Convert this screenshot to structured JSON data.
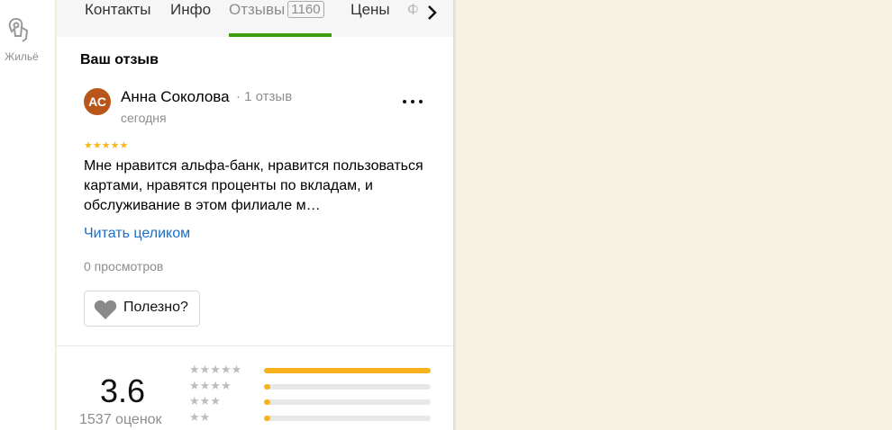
{
  "rail": {
    "housing_label": "Жильё",
    "housing_icon": "housing-icon"
  },
  "tabs": {
    "items": [
      {
        "label": "Контакты"
      },
      {
        "label": "Инфо"
      },
      {
        "label": "Отзывы",
        "badge": "1160",
        "active": true
      },
      {
        "label": "Цены"
      },
      {
        "label": "Ф"
      }
    ],
    "next_icon": "chevron-right-icon"
  },
  "your_review": {
    "title": "Ваш отзыв"
  },
  "review": {
    "avatar_initials": "АС",
    "author": "Анна Соколова",
    "author_meta": "· 1 отзыв",
    "date": "сегодня",
    "rating": 5,
    "stars": "★★★★★",
    "text": "Мне нравится альфа-банк, нравится пользоваться картами, нравятся проценты по вкладам, и обслуживание в этом филиале м…",
    "read_more": "Читать целиком",
    "views": "0 просмотров",
    "helpful_label": "Полезно?",
    "helpful_icon": "heart-icon",
    "more_icon": "more-dots-icon"
  },
  "rating_summary": {
    "score": "3.6",
    "count": "1537 оценок",
    "distribution": [
      {
        "stars": "★★★★★",
        "fraction": 1.0
      },
      {
        "stars": "★★★★",
        "fraction": 0.04
      },
      {
        "stars": "★★★",
        "fraction": 0.04
      },
      {
        "stars": "★★",
        "fraction": 0.04
      }
    ]
  },
  "colors": {
    "accent_green": "#3b9f0d",
    "link_blue": "#1a6ec9",
    "star_yellow": "#f5b81c",
    "avatar_bg": "#b8561a",
    "map_bg": "#f8f2e2"
  }
}
